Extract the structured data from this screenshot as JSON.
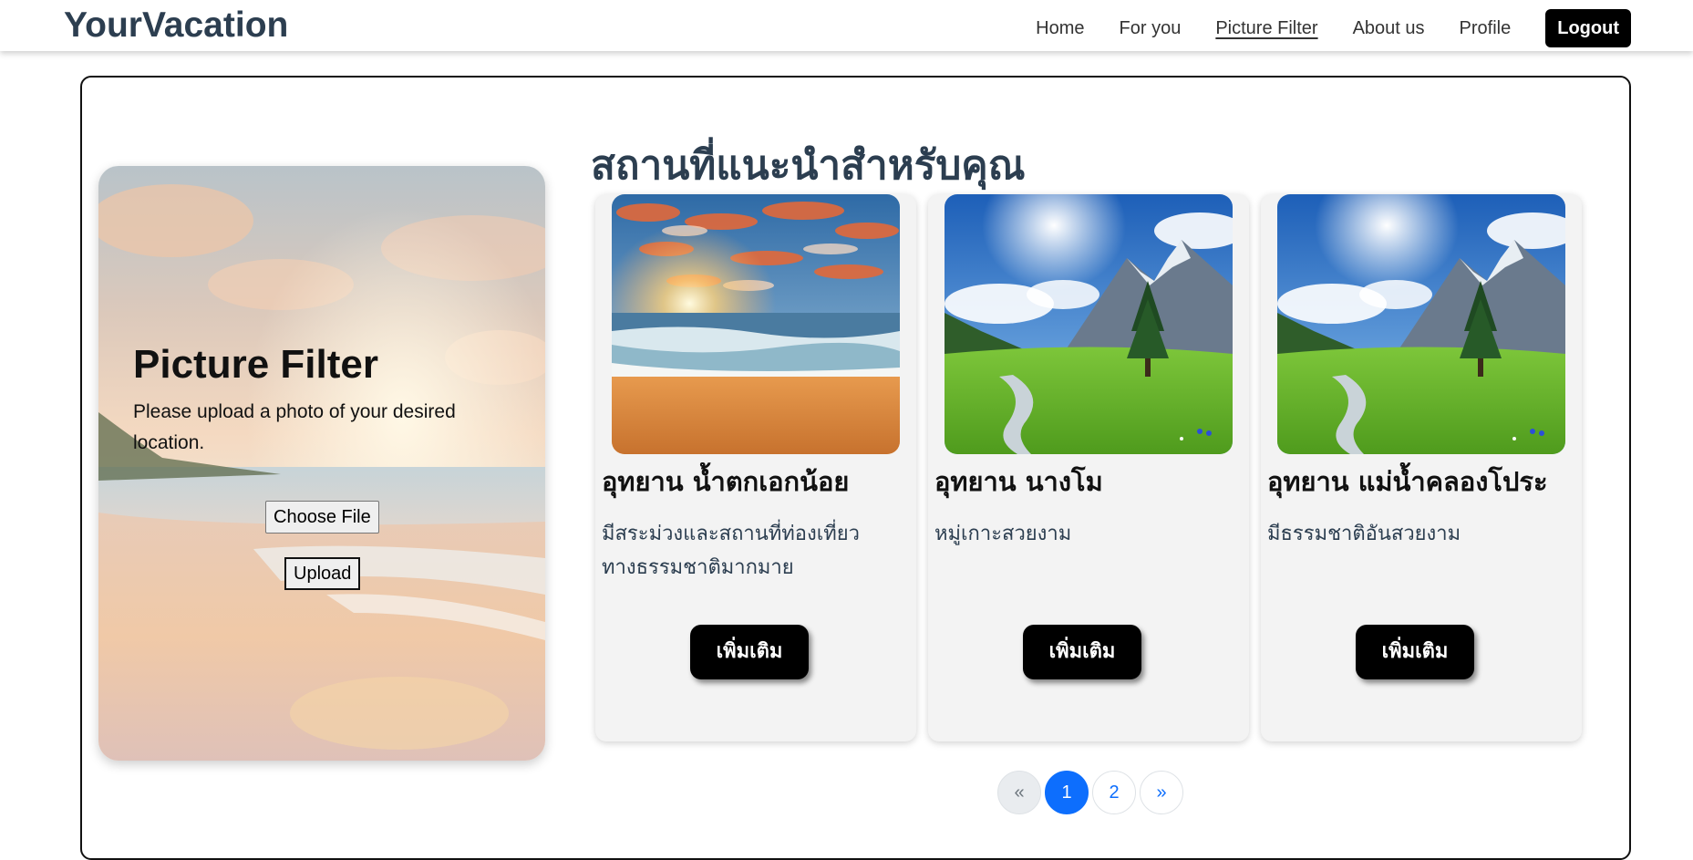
{
  "brand": "YourVacation",
  "nav": {
    "home": "Home",
    "for_you": "For you",
    "picture_filter": "Picture Filter",
    "about_us": "About us",
    "profile": "Profile",
    "logout": "Logout"
  },
  "upload": {
    "title": "Picture Filter",
    "description": "Please upload a photo of your desired location.",
    "choose_file": "Choose File",
    "upload_button": "Upload"
  },
  "section_title": "สถานที่แนะนำสำหรับคุณ",
  "cards": [
    {
      "title": "อุทยาน น้ำตกเอกน้อย",
      "description": "มีสระม่วงและสถานที่ท่องเที่ยวทางธรรมชาติมากมาย",
      "button": "เพิ่มเติม",
      "image": "beach-sunset"
    },
    {
      "title": "อุทยาน นางโม",
      "description": "หมู่เกาะสวยงาม",
      "button": "เพิ่มเติม",
      "image": "mountain-meadow"
    },
    {
      "title": "อุทยาน แม่น้ำคลองโประ",
      "description": "มีธรรมชาติอันสวยงาม",
      "button": "เพิ่มเติม",
      "image": "mountain-meadow"
    }
  ],
  "pagination": {
    "prev": "«",
    "pages": [
      "1",
      "2"
    ],
    "active_page": "1",
    "next": "»"
  },
  "colors": {
    "brand": "#2c3e50",
    "accent": "#0d6efd",
    "button": "#000000"
  }
}
